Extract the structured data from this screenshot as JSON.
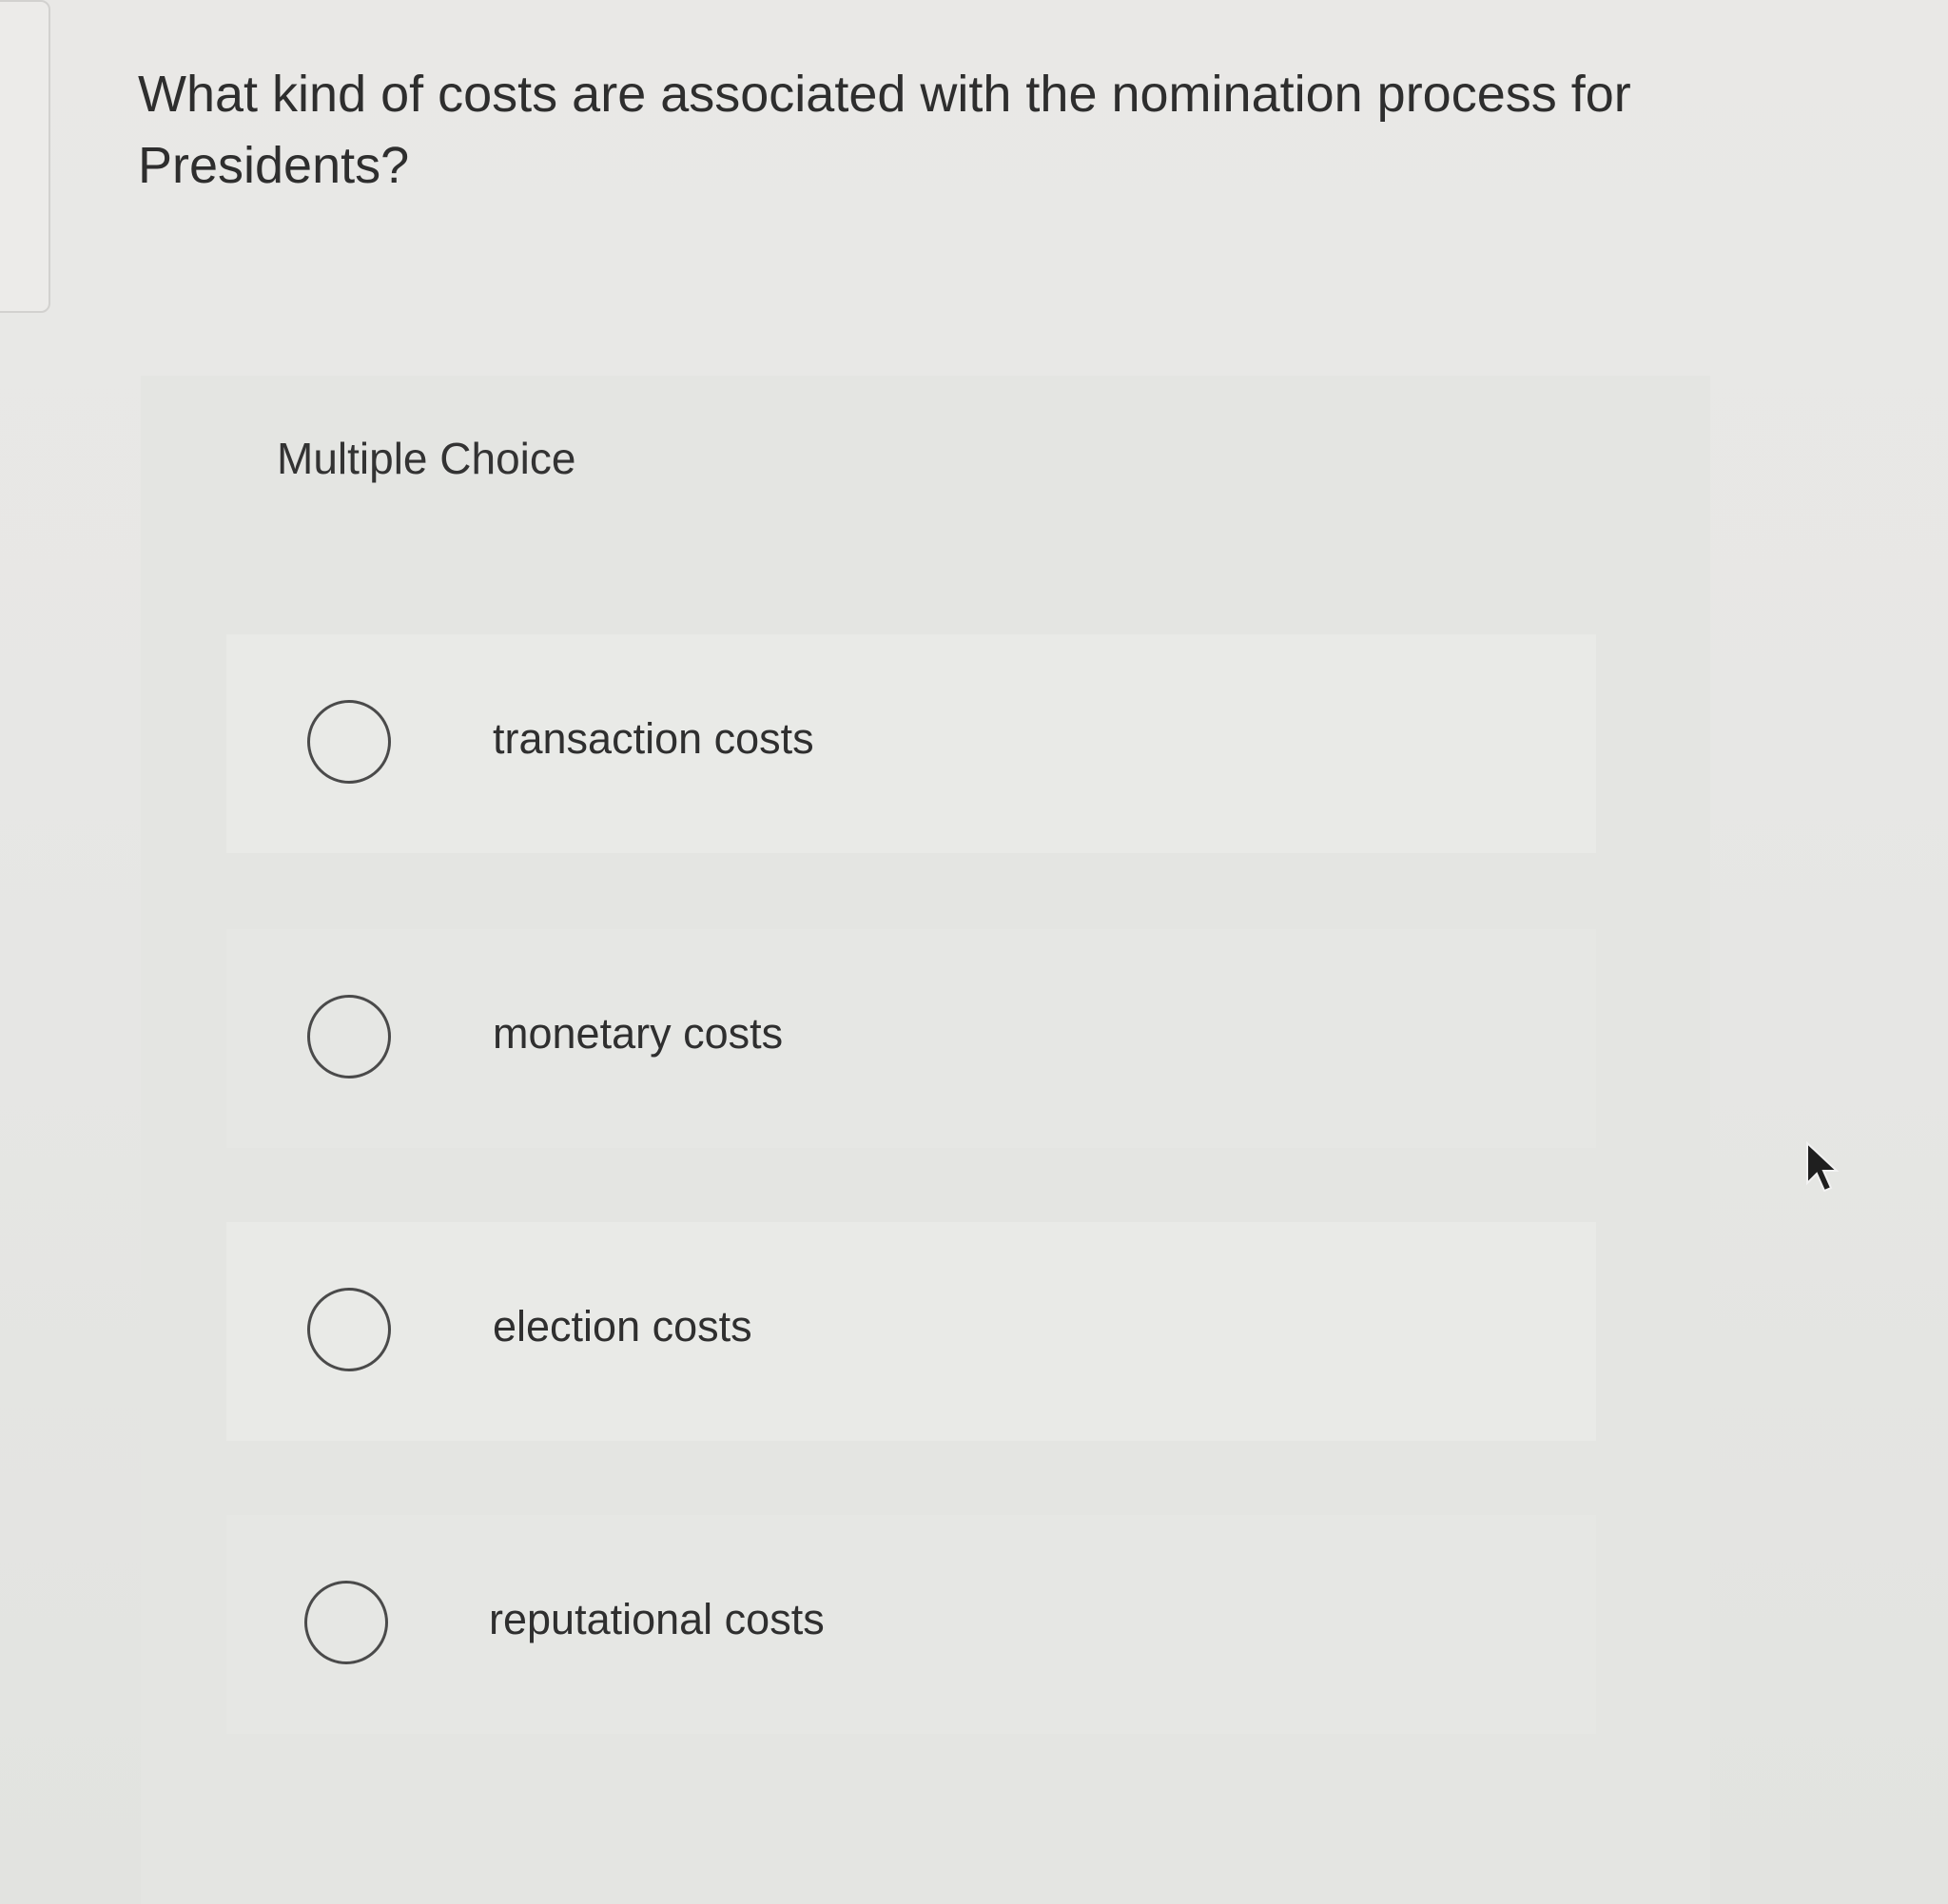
{
  "question": {
    "text": "What kind of costs are associated with the nomination process for Presidents?"
  },
  "panel": {
    "label": "Multiple Choice"
  },
  "options": [
    {
      "label": "transaction costs",
      "selected": false
    },
    {
      "label": "monetary costs",
      "selected": false
    },
    {
      "label": "election costs",
      "selected": false
    },
    {
      "label": "reputational costs",
      "selected": false
    }
  ],
  "icons": {
    "radio": "radio-empty-icon",
    "cursor": "mouse-pointer-icon"
  },
  "colors": {
    "page_background": "#e8e8e6",
    "panel_background": "#e4e5e2",
    "text": "#2e2e2e",
    "radio_border": "#4a4a4a"
  }
}
